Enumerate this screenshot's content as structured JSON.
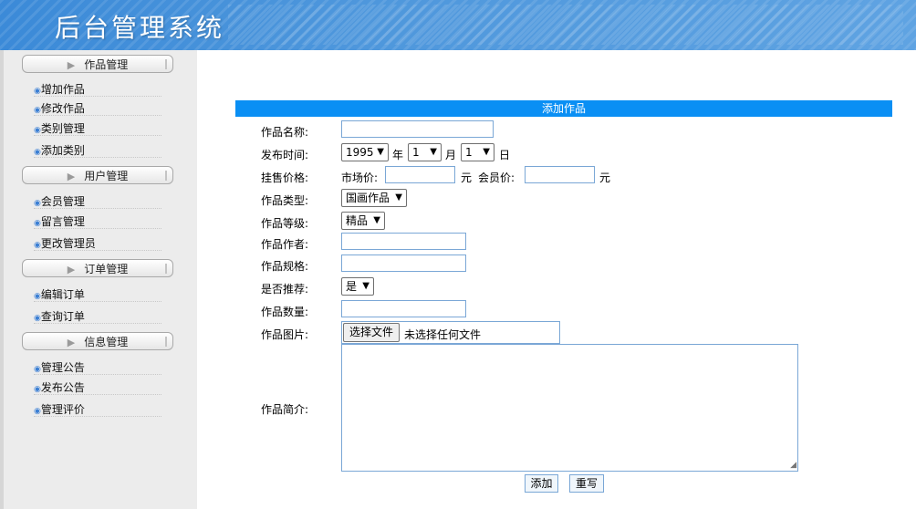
{
  "header": {
    "title": "后台管理系统"
  },
  "sidebar": {
    "groups": [
      {
        "title": "作品管理",
        "items": [
          "增加作品",
          "修改作品",
          "类别管理",
          "添加类别"
        ]
      },
      {
        "title": "用户管理",
        "items": [
          "会员管理",
          "留言管理",
          "更改管理员"
        ]
      },
      {
        "title": "订单管理",
        "items": [
          "编辑订单",
          "查询订单"
        ]
      },
      {
        "title": "信息管理",
        "items": [
          "管理公告",
          "发布公告",
          "管理评价"
        ]
      }
    ]
  },
  "form": {
    "title": "添加作品",
    "name_label": "作品名称:",
    "date_label": "发布时间:",
    "year_value": "1995",
    "year_unit": "年",
    "month_value": "1",
    "month_unit": "月",
    "day_value": "1",
    "day_unit": "日",
    "price_label": "挂售价格:",
    "market_price_label": "市场价:",
    "currency_unit": "元",
    "member_price_label": "会员价:",
    "type_label": "作品类型:",
    "type_value": "国画作品",
    "grade_label": "作品等级:",
    "grade_value": "精品",
    "author_label": "作品作者:",
    "spec_label": "作品规格:",
    "recommend_label": "是否推荐:",
    "recommend_value": "是",
    "quantity_label": "作品数量:",
    "image_label": "作品图片:",
    "file_button": "选择文件",
    "file_status": "未选择任何文件",
    "intro_label": "作品简介:",
    "submit_button": "添加",
    "reset_button": "重写"
  }
}
